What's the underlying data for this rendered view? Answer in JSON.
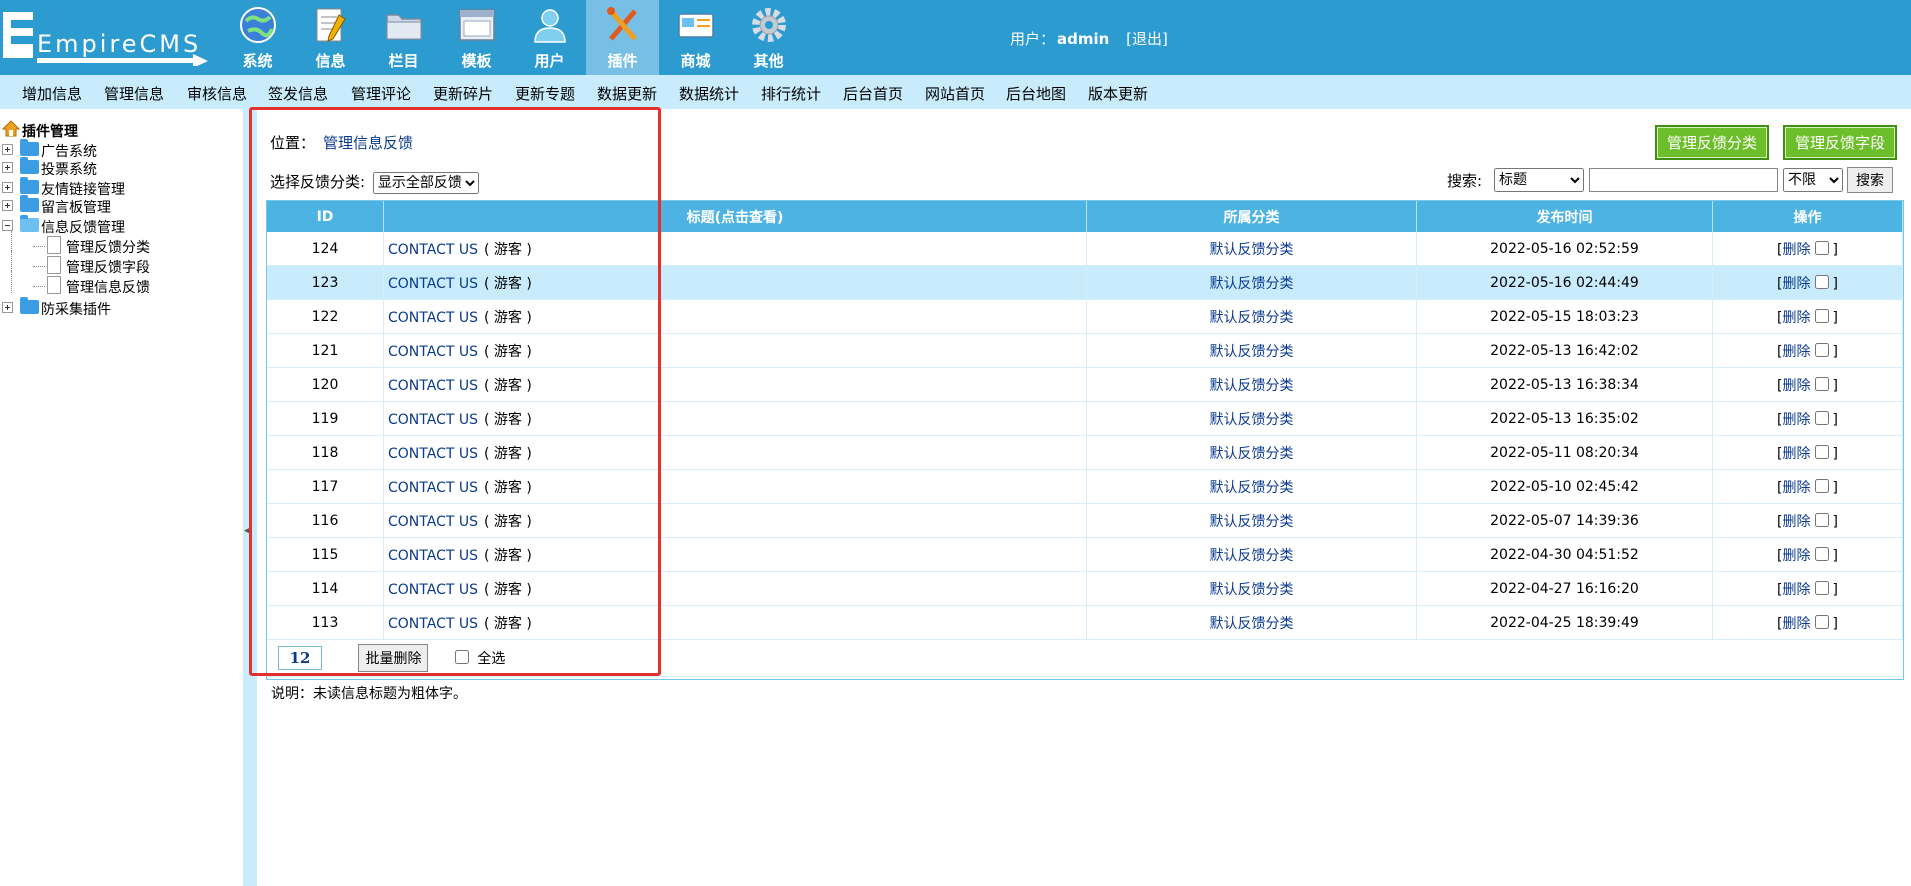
{
  "header": {
    "logo_text": "EmpireCMS",
    "nav": [
      {
        "label": "系统",
        "icon": "globe-icon"
      },
      {
        "label": "信息",
        "icon": "notepad-icon"
      },
      {
        "label": "栏目",
        "icon": "folder-icon"
      },
      {
        "label": "模板",
        "icon": "window-icon"
      },
      {
        "label": "用户",
        "icon": "user-icon"
      },
      {
        "label": "插件",
        "icon": "tools-icon",
        "active": true
      },
      {
        "label": "商城",
        "icon": "card-icon"
      },
      {
        "label": "其他",
        "icon": "gear-icon"
      }
    ],
    "user_label": "用户：",
    "username": "admin",
    "logout": "[退出]"
  },
  "menu": [
    "增加信息",
    "管理信息",
    "审核信息",
    "签发信息",
    "管理评论",
    "更新碎片",
    "更新专题",
    "数据更新",
    "数据统计",
    "排行统计",
    "后台首页",
    "网站首页",
    "后台地图",
    "版本更新"
  ],
  "sidebar": {
    "root": "插件管理",
    "items": [
      {
        "label": "广告系统",
        "type": "folder"
      },
      {
        "label": "投票系统",
        "type": "folder"
      },
      {
        "label": "友情链接管理",
        "type": "folder"
      },
      {
        "label": "留言板管理",
        "type": "folder"
      },
      {
        "label": "信息反馈管理",
        "type": "folder-open"
      },
      {
        "label": "管理反馈分类",
        "type": "doc"
      },
      {
        "label": "管理反馈字段",
        "type": "doc"
      },
      {
        "label": "管理信息反馈",
        "type": "doc"
      },
      {
        "label": "防采集插件",
        "type": "folder"
      }
    ]
  },
  "main": {
    "location_label": "位置：",
    "location_link": "管理信息反馈",
    "btn_manage_class": "管理反馈分类",
    "btn_manage_field": "管理反馈字段",
    "filter_label": "选择反馈分类:",
    "filter_value": "显示全部反馈",
    "search_label": "搜索:",
    "search_field": "标题",
    "search_range": "不限",
    "search_button": "搜索",
    "columns": [
      "ID",
      "标题(点击查看)",
      "所属分类",
      "发布时间",
      "操作"
    ],
    "rows": [
      {
        "id": "124",
        "title": "CONTACT US",
        "guest": "( 游客 )",
        "category": "默认反馈分类",
        "time": "2022-05-16 02:52:59"
      },
      {
        "id": "123",
        "title": "CONTACT US",
        "guest": "( 游客 )",
        "category": "默认反馈分类",
        "time": "2022-05-16 02:44:49"
      },
      {
        "id": "122",
        "title": "CONTACT US",
        "guest": "( 游客 )",
        "category": "默认反馈分类",
        "time": "2022-05-15 18:03:23"
      },
      {
        "id": "121",
        "title": "CONTACT US",
        "guest": "( 游客 )",
        "category": "默认反馈分类",
        "time": "2022-05-13 16:42:02"
      },
      {
        "id": "120",
        "title": "CONTACT US",
        "guest": "( 游客 )",
        "category": "默认反馈分类",
        "time": "2022-05-13 16:38:34"
      },
      {
        "id": "119",
        "title": "CONTACT US",
        "guest": "( 游客 )",
        "category": "默认反馈分类",
        "time": "2022-05-13 16:35:02"
      },
      {
        "id": "118",
        "title": "CONTACT US",
        "guest": "( 游客 )",
        "category": "默认反馈分类",
        "time": "2022-05-11 08:20:34"
      },
      {
        "id": "117",
        "title": "CONTACT US",
        "guest": "( 游客 )",
        "category": "默认反馈分类",
        "time": "2022-05-10 02:45:42"
      },
      {
        "id": "116",
        "title": "CONTACT US",
        "guest": "( 游客 )",
        "category": "默认反馈分类",
        "time": "2022-05-07 14:39:36"
      },
      {
        "id": "115",
        "title": "CONTACT US",
        "guest": "( 游客 )",
        "category": "默认反馈分类",
        "time": "2022-04-30 04:51:52"
      },
      {
        "id": "114",
        "title": "CONTACT US",
        "guest": "( 游客 )",
        "category": "默认反馈分类",
        "time": "2022-04-27 16:16:20"
      },
      {
        "id": "113",
        "title": "CONTACT US",
        "guest": "( 游客 )",
        "category": "默认反馈分类",
        "time": "2022-04-25 18:39:49"
      }
    ],
    "delete_label": "删除",
    "count": "12",
    "batch_delete": "批量删除",
    "select_all": "全选",
    "note": "说明：未读信息标题为粗体字。"
  },
  "colors": {
    "header": "#2b9bd0",
    "menubar": "#c8ecfc",
    "table_header": "#4db3e2",
    "highlight_row": "#c8ecfc",
    "green_button": "#6cbf2a",
    "annotation": "#e53030"
  }
}
